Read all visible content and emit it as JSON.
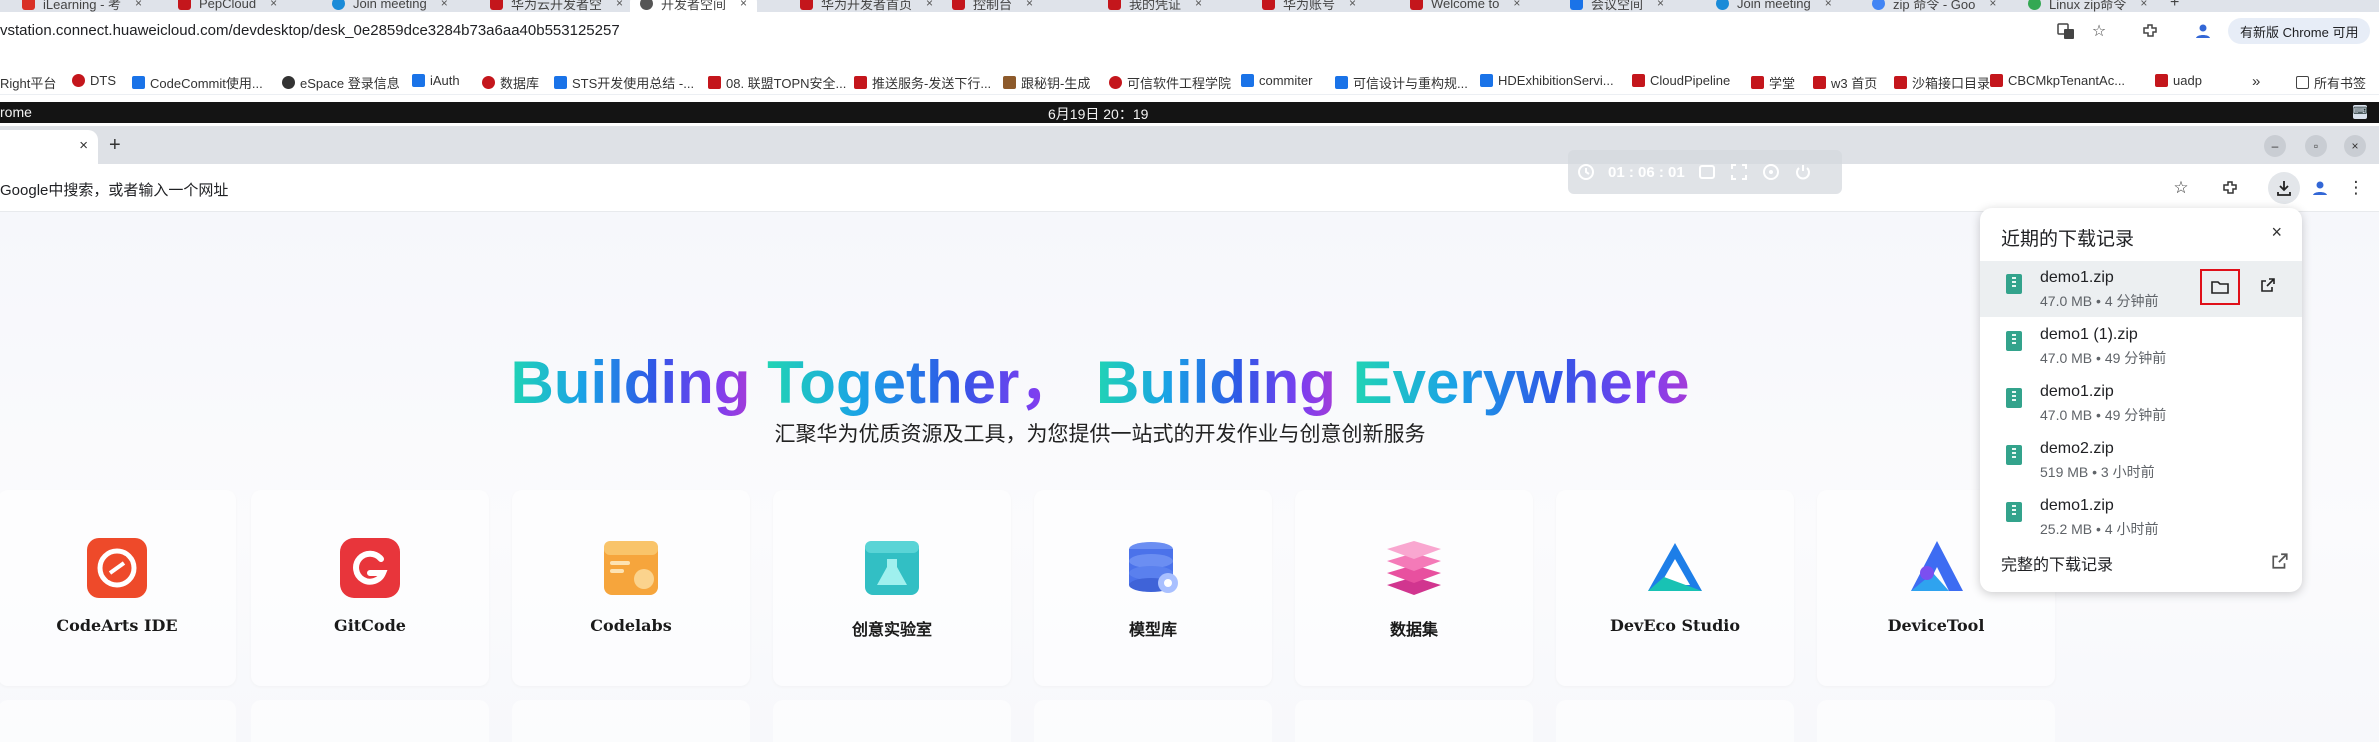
{
  "outer_browser": {
    "tabs": [
      {
        "label": "iLearning - 考",
        "color": "#d93025"
      },
      {
        "label": "PepCloud",
        "color": "#c4161c"
      },
      {
        "label": "Join meeting",
        "color": "#1a8bd8"
      },
      {
        "label": "华为云开发者空",
        "color": "#c4161c"
      },
      {
        "label": "开发者空间",
        "color": "#555555",
        "active": true
      },
      {
        "label": "华为开发者首页",
        "color": "#c4161c"
      },
      {
        "label": "控制台",
        "color": "#c4161c"
      },
      {
        "label": "我的凭证",
        "color": "#c4161c"
      },
      {
        "label": "华为账号",
        "color": "#c4161c"
      },
      {
        "label": "Welcome to",
        "color": "#c4161c"
      },
      {
        "label": "会议空间",
        "color": "#1a73e8"
      },
      {
        "label": "Join meeting",
        "color": "#1a8bd8"
      },
      {
        "label": "zip 命令 - Goo",
        "color": "#4285f4"
      },
      {
        "label": "Linux zip命令",
        "color": "#34a853"
      }
    ],
    "url": "vstation.connect.huaweicloud.com/devdesktop/desk_0e2859dce3284b73a6aa40b553125257",
    "update_button": "有新版 Chrome 可用",
    "bookmarks": [
      {
        "label": "Right平台",
        "color": "#e33"
      },
      {
        "label": "DTS",
        "color": "#c4161c"
      },
      {
        "label": "CodeCommit使用...",
        "color": "#1a73e8"
      },
      {
        "label": "eSpace 登录信息",
        "color": "#333333"
      },
      {
        "label": "iAuth",
        "color": "#1a73e8"
      },
      {
        "label": "数据库",
        "color": "#c4161c"
      },
      {
        "label": "STS开发使用总结 -...",
        "color": "#1a73e8"
      },
      {
        "label": "08. 联盟TOPN安全...",
        "color": "#c4161c"
      },
      {
        "label": "推送服务-发送下行...",
        "color": "#c4161c"
      },
      {
        "label": "跟秘钥-生成",
        "color": "#8d5a2b"
      },
      {
        "label": "可信软件工程学院",
        "color": "#c4161c"
      },
      {
        "label": "commiter",
        "color": "#1a73e8"
      },
      {
        "label": "可信设计与重构规...",
        "color": "#1a73e8"
      },
      {
        "label": "HDExhibitionServi...",
        "color": "#1a73e8"
      },
      {
        "label": "CloudPipeline",
        "color": "#c4161c"
      },
      {
        "label": "学堂",
        "color": "#c4161c"
      },
      {
        "label": "w3 首页",
        "color": "#c4161c"
      },
      {
        "label": "沙箱接口目录",
        "color": "#c4161c"
      },
      {
        "label": "CBCMkpTenantAc...",
        "color": "#c4161c"
      },
      {
        "label": "uadp",
        "color": "#c4161c"
      }
    ],
    "bookmarks_more": "»",
    "all_bookmarks": "所有书签"
  },
  "remote_desktop": {
    "app_name": "rome",
    "clock": "6月19日  20：19",
    "session_timer": "01 : 06 : 01"
  },
  "inner_browser": {
    "tab_close": "×",
    "new_tab": "+",
    "omnibox_placeholder": "Google中搜索，或者输入一个网址",
    "window_controls": [
      "–",
      "▫",
      "×"
    ]
  },
  "hero": {
    "title_words": [
      "Building",
      "Together，",
      "Building",
      "Everywhere"
    ],
    "subtitle": "汇聚华为优质资源及工具，为您提供一站式的开发作业与创意创新服务"
  },
  "tools": [
    {
      "label": "CodeArts IDE",
      "icon": "codearts-ide-icon"
    },
    {
      "label": "GitCode",
      "icon": "gitcode-icon"
    },
    {
      "label": "Codelabs",
      "icon": "codelabs-icon"
    },
    {
      "label": "创意实验室",
      "icon": "creative-lab-icon"
    },
    {
      "label": "模型库",
      "icon": "model-library-icon"
    },
    {
      "label": "数据集",
      "icon": "dataset-icon"
    },
    {
      "label": "DevEco Studio",
      "icon": "deveco-studio-icon"
    },
    {
      "label": "DeviceTool",
      "icon": "devicetool-icon"
    }
  ],
  "downloads": {
    "title": "近期的下载记录",
    "close": "×",
    "items": [
      {
        "name": "demo1.zip",
        "meta": "47.0 MB • 4 分钟前"
      },
      {
        "name": "demo1 (1).zip",
        "meta": "47.0 MB • 49 分钟前"
      },
      {
        "name": "demo1.zip",
        "meta": "47.0 MB • 49 分钟前"
      },
      {
        "name": "demo2.zip",
        "meta": "519 MB • 3 小时前"
      },
      {
        "name": "demo1.zip",
        "meta": "25.2 MB • 4 小时前"
      }
    ],
    "footer": "完整的下载记录"
  }
}
